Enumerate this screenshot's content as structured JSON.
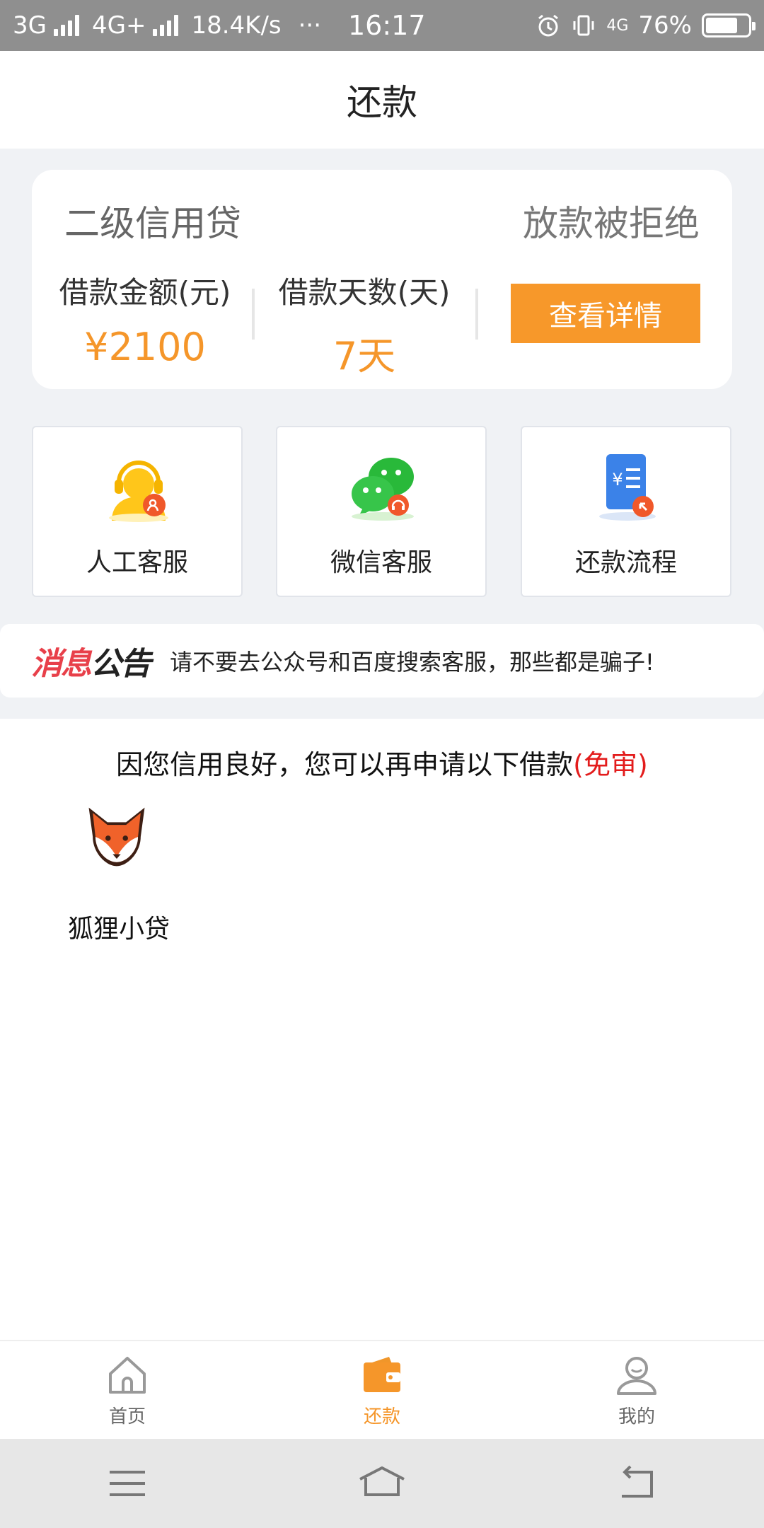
{
  "status_bar": {
    "net1": "3G",
    "net2": "4G+",
    "speed": "18.4K/s",
    "dots": "···",
    "time": "16:17",
    "net3": "4G",
    "battery": "76%",
    "battery_level": 0.76
  },
  "header": {
    "title": "还款"
  },
  "loan": {
    "product": "二级信用贷",
    "status": "放款被拒绝",
    "amount_label": "借款金额(元)",
    "amount_value": "¥2100",
    "days_label": "借款天数(天)",
    "days_value": "7天",
    "detail_button": "查看详情"
  },
  "services": [
    {
      "label": "人工客服",
      "icon": "customer-service-icon"
    },
    {
      "label": "微信客服",
      "icon": "wechat-icon"
    },
    {
      "label": "还款流程",
      "icon": "repayment-process-icon"
    }
  ],
  "notice": {
    "tag_a": "消息",
    "tag_b": "公告",
    "message": "请不要去公众号和百度搜索客服，那些都是骗子!"
  },
  "recommend": {
    "intro": "因您信用良好，您可以再申请以下借款",
    "intro_highlight": "(免审)",
    "apps": [
      {
        "name": "狐狸小贷",
        "icon": "fox-icon"
      }
    ]
  },
  "bottom_nav": [
    {
      "label": "首页",
      "icon": "home-icon"
    },
    {
      "label": "还款",
      "icon": "wallet-icon",
      "active": true
    },
    {
      "label": "我的",
      "icon": "profile-icon"
    }
  ],
  "colors": {
    "accent": "#f5962a",
    "button": "#f7982a",
    "red": "#e31c1c"
  }
}
